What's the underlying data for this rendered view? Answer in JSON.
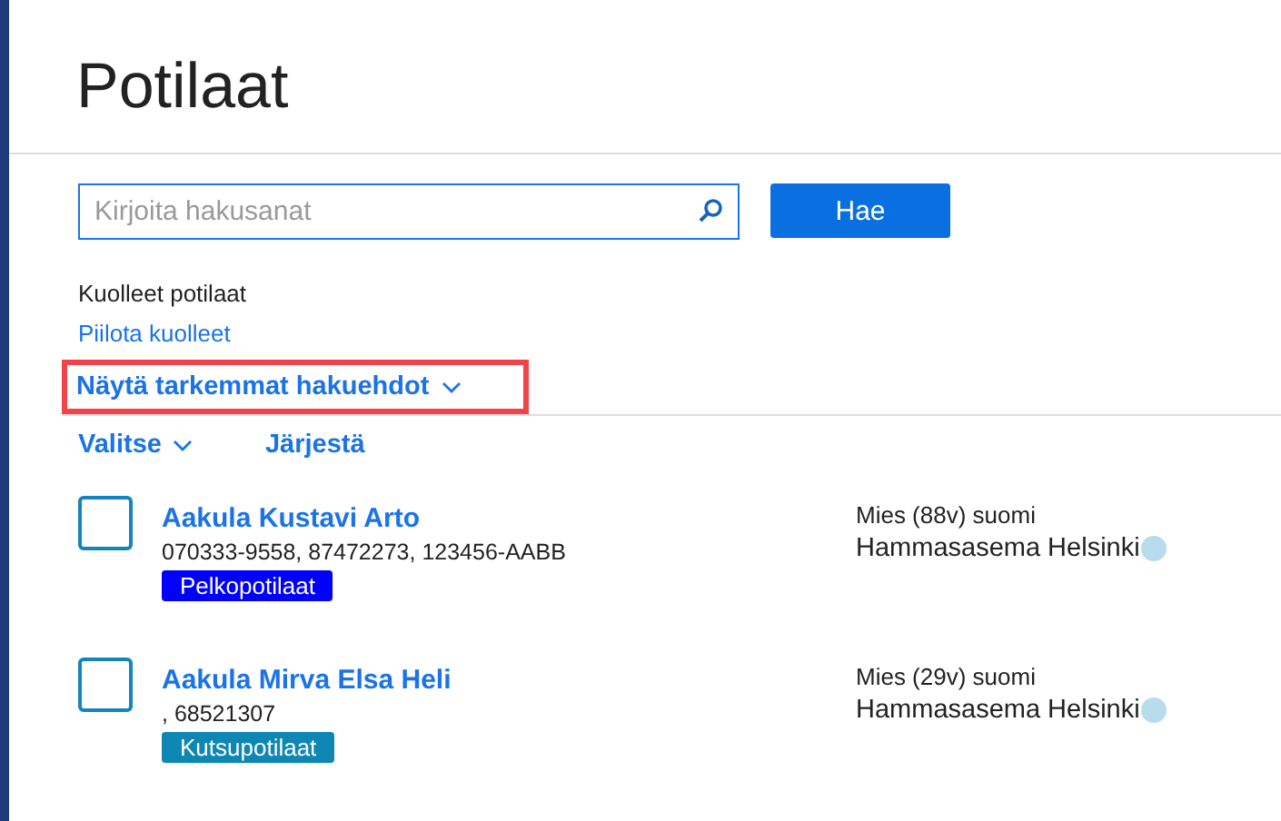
{
  "title": "Potilaat",
  "search": {
    "placeholder": "Kirjoita hakusanat",
    "button": "Hae"
  },
  "deceased": {
    "label": "Kuolleet potilaat",
    "link": "Piilota kuolleet"
  },
  "advanced": {
    "label": "Näytä tarkemmat hakuehdot",
    "highlighted": true
  },
  "toolbar": {
    "select": "Valitse",
    "sort": "Järjestä"
  },
  "patients": [
    {
      "name": "Aakula Kustavi Arto",
      "ids": "070333-9558, 87472273, 123456-AABB",
      "tag": {
        "label": "Pelkopotilaat",
        "color": "#0000ff"
      },
      "info": "Mies (88v) suomi",
      "clinic": "Hammasasema Helsinki",
      "checked": false
    },
    {
      "name": "Aakula Mirva Elsa Heli",
      "ids": ", 68521307",
      "tag": {
        "label": "Kutsupotilaat",
        "color": "#0e87b5"
      },
      "info": "Mies (29v) suomi",
      "clinic": "Hammasasema Helsinki",
      "checked": false
    }
  ]
}
